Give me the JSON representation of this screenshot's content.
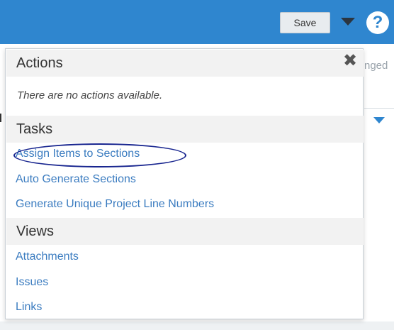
{
  "toolbar": {
    "save_label": "Save",
    "help_label": "?"
  },
  "background": {
    "fragment_text": "nged"
  },
  "panel": {
    "close_glyph": "✖",
    "actions": {
      "header": "Actions",
      "empty_note": "There are no actions available."
    },
    "tasks": {
      "header": "Tasks",
      "items": [
        "Assign Items to Sections",
        "Auto Generate Sections",
        "Generate Unique Project Line Numbers"
      ]
    },
    "views": {
      "header": "Views",
      "items": [
        "Attachments",
        "Issues",
        "Links"
      ]
    }
  },
  "colors": {
    "topbar": "#2f86cf",
    "link": "#3b7cc0",
    "annotation": "#18258f"
  }
}
